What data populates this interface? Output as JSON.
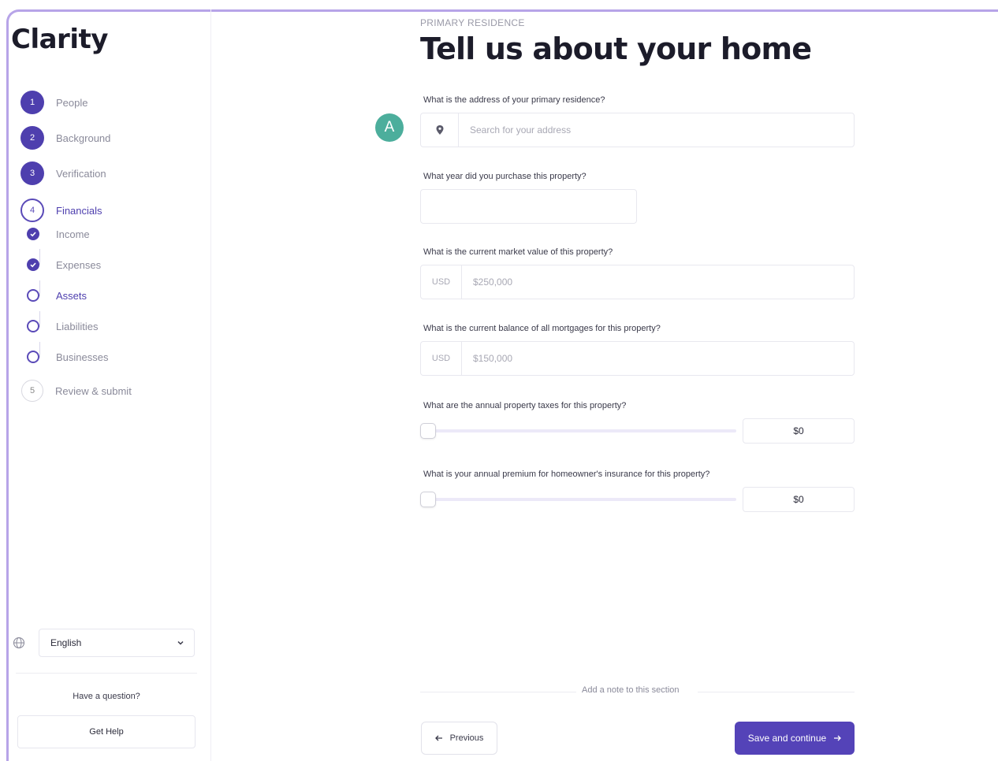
{
  "app": {
    "name": "Clarity"
  },
  "steps": [
    {
      "number": "1",
      "label": "People"
    },
    {
      "number": "2",
      "label": "Background"
    },
    {
      "number": "3",
      "label": "Verification"
    },
    {
      "number": "4",
      "label": "Financials"
    },
    {
      "number": "5",
      "label": "Review & submit"
    }
  ],
  "substeps": [
    {
      "label": "Income",
      "state": "checked"
    },
    {
      "label": "Expenses",
      "state": "checked"
    },
    {
      "label": "Assets",
      "state": "current"
    },
    {
      "label": "Liabilities",
      "state": "open"
    },
    {
      "label": "Businesses",
      "state": "open"
    }
  ],
  "sidebar_footer": {
    "language": "English",
    "question": "Have a question?",
    "help_label": "Get Help"
  },
  "main": {
    "eyebrow": "PRIMARY RESIDENCE",
    "title": "Tell us about your home",
    "annotation_badge": "A",
    "address": {
      "label": "What is the address of your primary residence?",
      "placeholder": "Search for your address"
    },
    "purchase_year": {
      "label": "What year did you purchase this property?",
      "value": ""
    },
    "market_value": {
      "label": "What is the current market value of this property?",
      "prefix": "USD",
      "placeholder": "$250,000"
    },
    "mortgage_balance": {
      "label": "What is the current balance of all mortgages for this property?",
      "prefix": "USD",
      "placeholder": "$150,000"
    },
    "property_taxes": {
      "label": "What are the annual property taxes for this property?",
      "value": "$0",
      "slider_level": 0
    },
    "insurance": {
      "label": "What is your annual premium for homeowner's insurance for this property?",
      "value": "$0",
      "slider_level": 0
    },
    "note_label": "Add a note to this section",
    "previous_label": "Previous",
    "save_label": "Save and continue"
  },
  "colors": {
    "brand": "#5443b8",
    "badge": "#4cae9c",
    "frame": "#b7a4e8"
  }
}
